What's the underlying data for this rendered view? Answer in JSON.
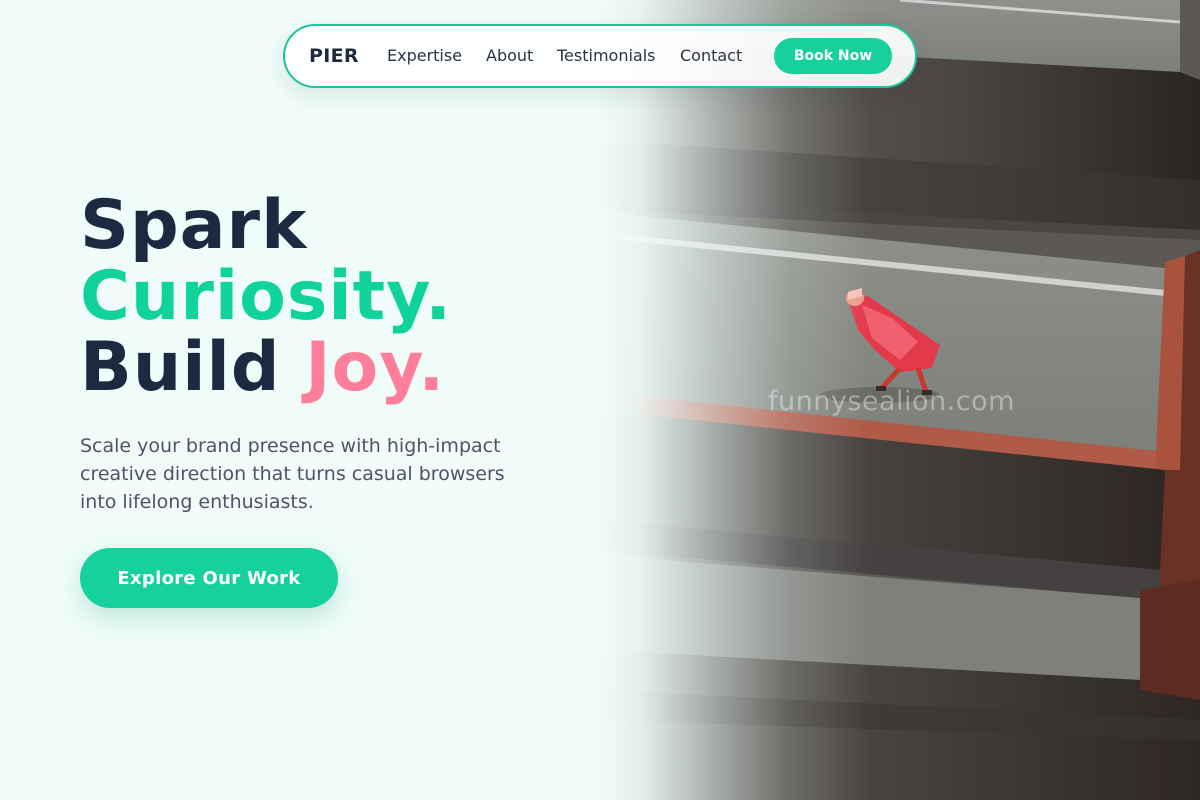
{
  "nav": {
    "brand": "PIER",
    "links": [
      "Expertise",
      "About",
      "Testimonials",
      "Contact"
    ],
    "cta": "Book Now"
  },
  "hero": {
    "line1": "Spark",
    "line2": "Curiosity.",
    "line3_a": "Build",
    "line3_b": "Joy.",
    "subtext": "Scale your brand presence with high-impact creative direction that turns casual browsers into lifelong enthusiasts.",
    "cta": "Explore Our Work"
  },
  "image": {
    "watermark": "funnysealion.com"
  },
  "colors": {
    "background": "#effcf9",
    "accent_green": "#16d19c",
    "accent_pink": "#ff7f9a",
    "text_dark": "#1b2a41"
  }
}
